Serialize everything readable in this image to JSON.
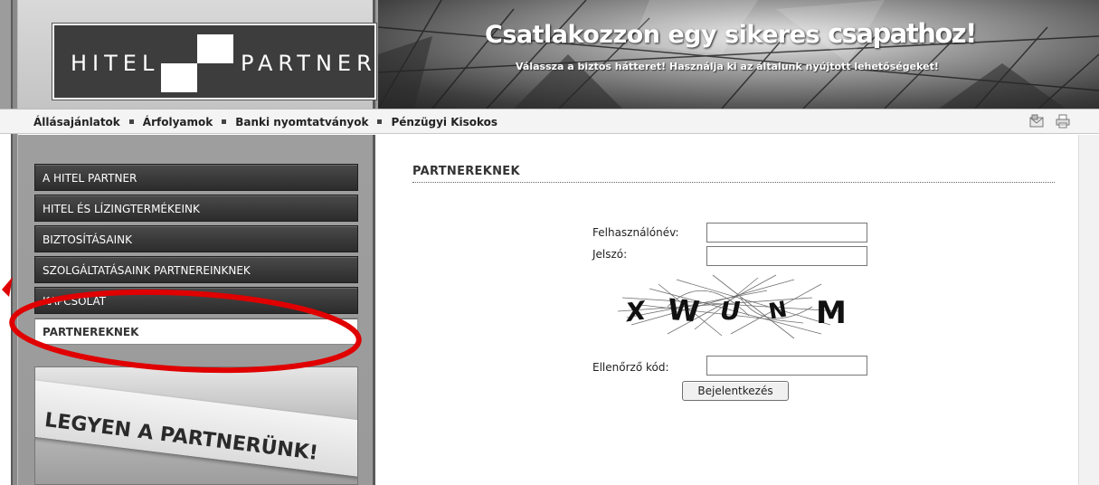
{
  "logo": {
    "word1": "HITEL",
    "word2": "PARTNER"
  },
  "banner": {
    "title_part1": "Csatlakozzon egy sikeres ",
    "title_part2": "csapathoz!",
    "subtitle": "Válassza a biztos hátteret! Használja ki az általunk nyújtott lehetőségeket!"
  },
  "topnav": {
    "links": [
      "Állásajánlatok",
      "Árfolyamok",
      "Banki nyomtatványok",
      "Pénzügyi Kisokos"
    ],
    "icons": [
      "email-icon",
      "printer-icon"
    ]
  },
  "sidebar": {
    "menu": [
      {
        "label": "A HITEL PARTNER"
      },
      {
        "label": "HITEL ÉS LÍZINGTERMÉKEINK"
      },
      {
        "label": "BIZTOSÍTÁSAINK"
      },
      {
        "label": "SZOLGÁLTATÁSAINK PARTNEREINKNEK"
      },
      {
        "label": "KAPCSOLAT"
      },
      {
        "label": "PARTNEREKNEK"
      }
    ],
    "active_index": 5,
    "promo_text": "LEGYEN A PARTNERÜNK!"
  },
  "main": {
    "title": "PARTNEREKNEK",
    "form": {
      "username_label": "Felhasználónév:",
      "username_value": "",
      "password_label": "Jelszó:",
      "password_value": "",
      "captcha_text": [
        "X",
        "W",
        "U",
        "N",
        "M"
      ],
      "code_label": "Ellenőrző kód:",
      "code_value": "",
      "submit_label": "Bejelentkezés"
    }
  },
  "annotation": {
    "color": "#e00000",
    "target": "PARTNEREKNEK"
  },
  "colors": {
    "menu_dark": "#2c2c2c",
    "sidebar_bg": "#9e9e9e",
    "accent_red": "#e00000"
  }
}
